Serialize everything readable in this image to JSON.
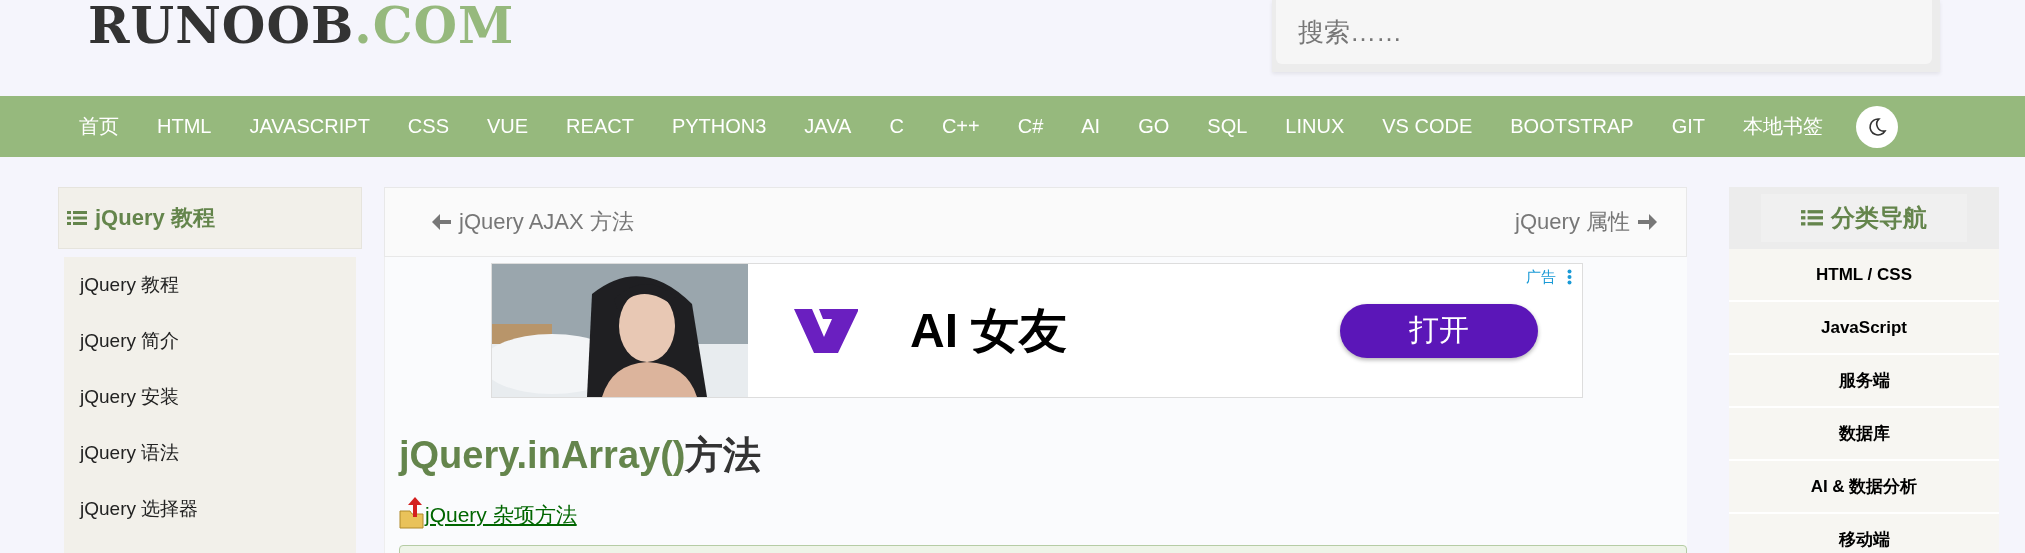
{
  "logo": {
    "name": "RUNOOB",
    "suffix": ".COM"
  },
  "search": {
    "placeholder": "搜索……"
  },
  "nav": {
    "items": [
      "首页",
      "HTML",
      "JAVASCRIPT",
      "CSS",
      "VUE",
      "REACT",
      "PYTHON3",
      "JAVA",
      "C",
      "C++",
      "C#",
      "AI",
      "GO",
      "SQL",
      "LINUX",
      "VS CODE",
      "BOOTSTRAP",
      "GIT",
      "本地书签"
    ]
  },
  "sidebar": {
    "title": "jQuery 教程",
    "items": [
      "jQuery 教程",
      "jQuery 简介",
      "jQuery 安装",
      "jQuery 语法",
      "jQuery 选择器"
    ]
  },
  "article": {
    "prev": "jQuery AJAX 方法",
    "next": "jQuery 属性",
    "ad": {
      "label": "广告",
      "headline": "AI 女友",
      "button": "打开"
    },
    "title_code": "jQuery.inArray()",
    "title_suffix": "方法",
    "parent_link": "jQuery 杂项方法"
  },
  "category_nav": {
    "title": "分类导航",
    "items": [
      "HTML / CSS",
      "JavaScript",
      "服务端",
      "数据库",
      "AI & 数据分析",
      "移动端"
    ]
  }
}
